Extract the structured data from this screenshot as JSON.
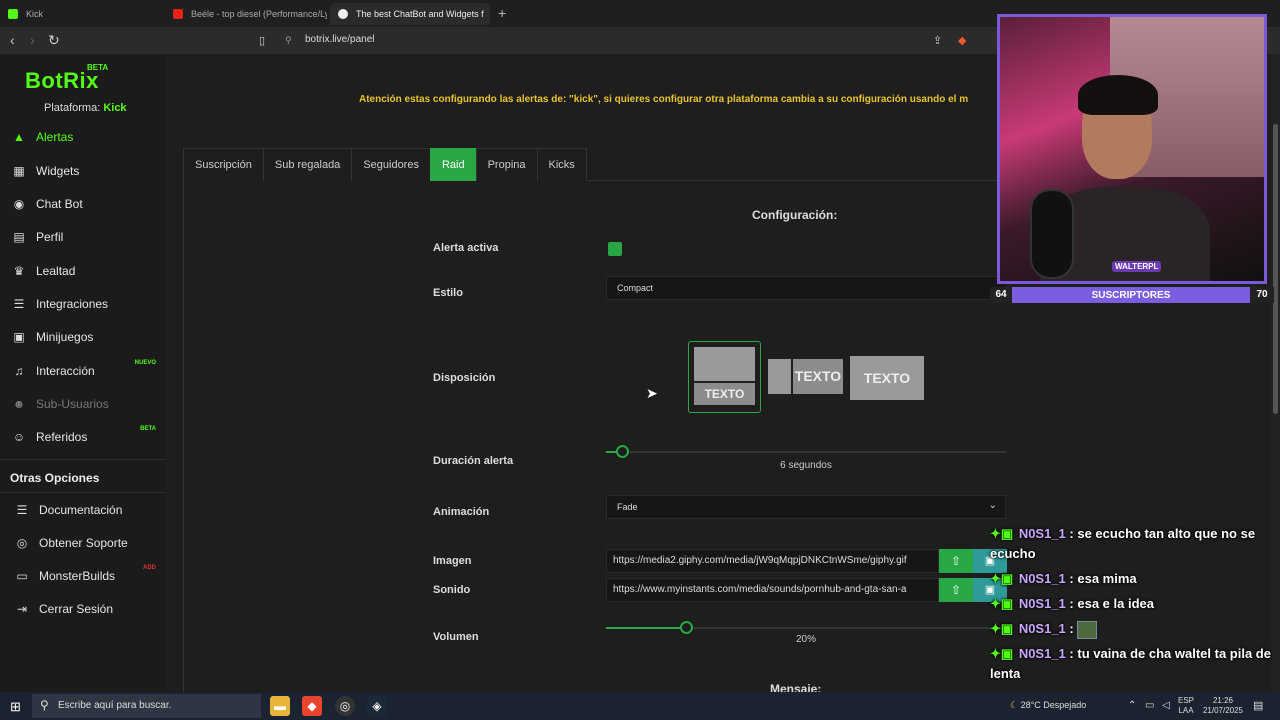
{
  "browser": {
    "tabs": [
      {
        "title": "Kick",
        "active": false
      },
      {
        "title": "Beéle - top diesel (Performance/Lyric",
        "active": false
      },
      {
        "title": "The best ChatBot and Widgets f",
        "active": true
      }
    ],
    "new_tab": "+",
    "url": "botrix.live/panel"
  },
  "sidebar": {
    "logo": "BotRix",
    "logo_badge": "BETA",
    "platform_label": "Plataforma:",
    "platform_value": "Kick",
    "items": [
      {
        "label": "Alertas",
        "icon": "warning-icon",
        "glyph": "▲"
      },
      {
        "label": "Widgets",
        "icon": "grid-icon",
        "glyph": "▦"
      },
      {
        "label": "Chat Bot",
        "icon": "robot-icon",
        "glyph": "◉"
      },
      {
        "label": "Perfil",
        "icon": "id-card-icon",
        "glyph": "▤"
      },
      {
        "label": "Lealtad",
        "icon": "trophy-icon",
        "glyph": "♛"
      },
      {
        "label": "Integraciones",
        "icon": "list-icon",
        "glyph": "☰"
      },
      {
        "label": "Minijuegos",
        "icon": "gamepad-icon",
        "glyph": "▣"
      },
      {
        "label": "Interacción",
        "icon": "music-icon",
        "glyph": "♫",
        "badge": "NUEVO"
      },
      {
        "label": "Sub-Usuarios",
        "icon": "users-icon",
        "glyph": "☻"
      },
      {
        "label": "Referidos",
        "icon": "users-group-icon",
        "glyph": "☺",
        "badge": "BETA"
      }
    ],
    "section_title": "Otras Opciones",
    "other_items": [
      {
        "label": "Documentación",
        "icon": "doc-icon",
        "glyph": "☰"
      },
      {
        "label": "Obtener Soporte",
        "icon": "support-icon",
        "glyph": "◎"
      },
      {
        "label": "MonsterBuilds",
        "icon": "laptop-icon",
        "glyph": "▭",
        "badge": "ADD"
      },
      {
        "label": "Cerrar Sesión",
        "icon": "logout-icon",
        "glyph": "⇥"
      }
    ]
  },
  "main": {
    "warning": "Atención estas configurando las alertas de: \"kick\", si quieres configurar otra plataforma cambia a su configuración usando el m",
    "tabs": [
      "Suscripción",
      "Sub regalada",
      "Seguidores",
      "Raid",
      "Propina",
      "Kicks"
    ],
    "active_tab": "Raid",
    "config_title": "Configuración:",
    "alert_active_label": "Alerta activa",
    "style_label": "Estilo",
    "style_value": "Compact",
    "layout_label": "Disposición",
    "layout_text": "TEXTO",
    "duration_label": "Duración alerta",
    "duration_value": "6 segundos",
    "duration_fraction": 0.04,
    "animation_label": "Animación",
    "animation_value": "Fade",
    "image_label": "Imagen",
    "image_value": "https://media2.giphy.com/media/jW9qMqpjDNKCtnWSme/giphy.gif",
    "sound_label": "Sonido",
    "sound_value": "https://www.myinstants.com/media/sounds/pornhub-and-gta-san-a",
    "volume_label": "Volumen",
    "volume_value": "20%",
    "volume_fraction": 0.2,
    "message_label": "Mensaje:"
  },
  "stream": {
    "cam_tag": "WALTERPL",
    "sub_left": "64",
    "sub_label": "SUSCRIPTORES",
    "sub_right": "70",
    "chat": [
      {
        "user": "N0S1_1",
        "text": ": se ecucho tan alto que no se ecucho"
      },
      {
        "user": "N0S1_1",
        "text": ": esa mima"
      },
      {
        "user": "N0S1_1",
        "text": ": esa e la idea"
      },
      {
        "user": "N0S1_1",
        "text": ":",
        "emote": true
      },
      {
        "user": "N0S1_1",
        "text": ": tu vaina de cha waltel ta pila de lenta"
      }
    ]
  },
  "taskbar": {
    "search_placeholder": "Escribe aquí para buscar.",
    "weather": "28°C  Despejado",
    "lang_top": "ESP",
    "lang_bottom": "LAA",
    "time": "21:26",
    "date": "21/07/2025"
  }
}
